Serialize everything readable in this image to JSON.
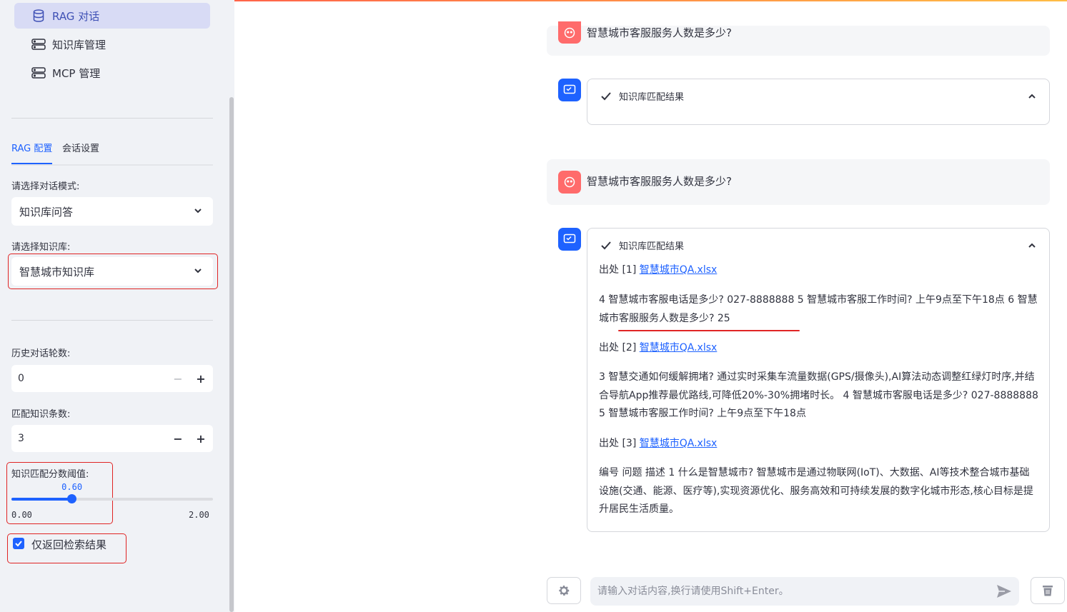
{
  "colors": {
    "accent": "#1e62ff",
    "highlight_box": "#e02424",
    "user_avatar": "#ff6b6b",
    "sidebar_bg": "#f0f2f6"
  },
  "nav": [
    {
      "label": "RAG 对话",
      "icon": "database-icon",
      "active": true
    },
    {
      "label": "知识库管理",
      "icon": "server-icon",
      "active": false
    },
    {
      "label": "MCP 管理",
      "icon": "server-icon",
      "active": false
    }
  ],
  "tabs": {
    "rag": "RAG 配置",
    "session": "会话设置"
  },
  "mode": {
    "label": "请选择对话模式:",
    "value": "知识库问答"
  },
  "kb": {
    "label": "请选择知识库:",
    "value": "智慧城市知识库"
  },
  "history": {
    "label": "历史对话轮数:",
    "value": "0"
  },
  "topk": {
    "label": "匹配知识条数:",
    "value": "3"
  },
  "threshold": {
    "label": "知识匹配分数阈值:",
    "value": "0.60",
    "min": "0.00",
    "max": "2.00",
    "fraction": 0.3
  },
  "only_retrieval": {
    "label": "仅返回检索结果",
    "checked": true
  },
  "messages": {
    "user_partial": "智慧城市客服服务人数是多少?",
    "expander_title": "知识库匹配结果",
    "user_question": "智慧城市客服服务人数是多少?",
    "source_prefix_1": "出处 [1] ",
    "source_link_1": "智慧城市QA.xlsx",
    "chunk_1": "4 智慧城市客服电话是多少? 027-8888888 5 智慧城市客服工作时间? 上午9点至下午18点 6 智慧城市客服服务人数是多少? 25",
    "source_prefix_2": "出处 [2] ",
    "source_link_2": "智慧城市QA.xlsx",
    "chunk_2": "3 智慧交通如何缓解拥堵? 通过实时采集车流量数据(GPS/摄像头),AI算法动态调整红绿灯时序,并结合导航App推荐最优路线,可降低20%-30%拥堵时长。 4 智慧城市客服电话是多少? 027-8888888 5 智慧城市客服工作时间? 上午9点至下午18点",
    "source_prefix_3": "出处 [3] ",
    "source_link_3": "智慧城市QA.xlsx",
    "chunk_3": "编号 问题 描述 1 什么是智慧城市? 智慧城市是通过物联网(IoT)、大数据、AI等技术整合城市基础设施(交通、能源、医疗等),实现资源优化、服务高效和可持续发展的数字化城市形态,核心目标是提升居民生活质量。"
  },
  "input": {
    "placeholder": "请输入对话内容,换行请使用Shift+Enter。"
  }
}
